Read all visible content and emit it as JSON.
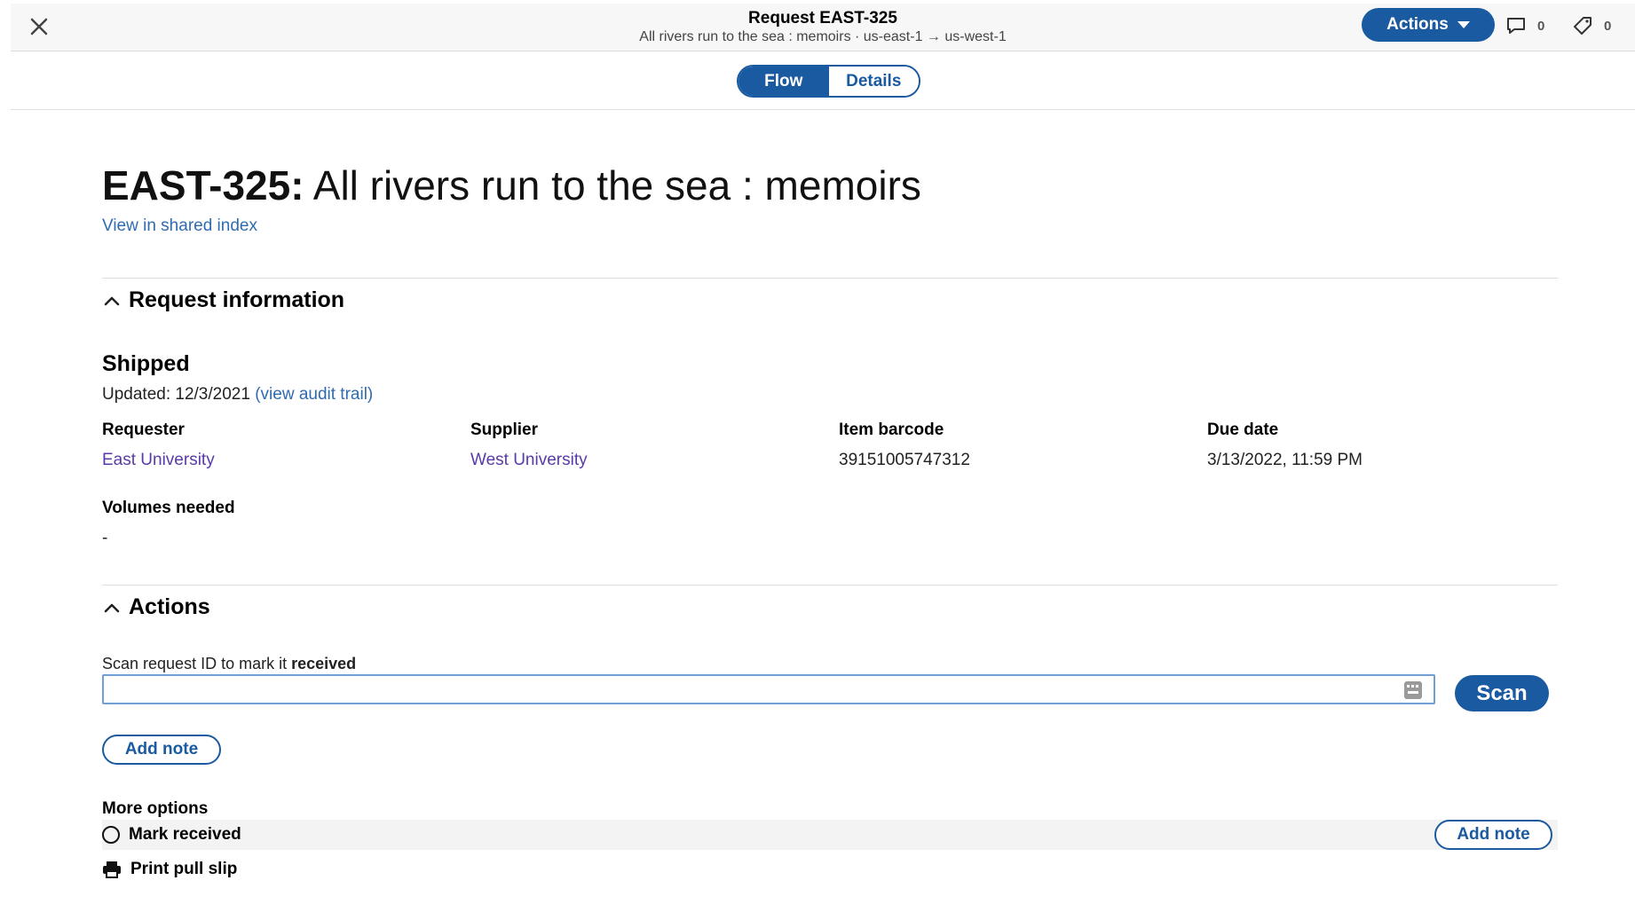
{
  "header": {
    "title": "Request EAST-325",
    "subtitle": "All rivers run to the sea : memoirs · us-east-1 → us-west-1",
    "actions_label": "Actions",
    "chat_count": "0",
    "tag_count": "0"
  },
  "tabs": [
    {
      "label": "Flow",
      "active": true
    },
    {
      "label": "Details",
      "active": false
    }
  ],
  "request": {
    "id_label": "EAST-325:",
    "title": "All rivers run to the sea : memoirs",
    "shared_index_link": "View in shared index"
  },
  "request_info": {
    "section_title": "Request information",
    "status": "Shipped",
    "updated_prefix": "Updated: 12/3/2021",
    "audit_link": "(view audit trail)",
    "fields": [
      {
        "label": "Requester",
        "value": "East University"
      },
      {
        "label": "Supplier",
        "value": "West University"
      },
      {
        "label": "Item barcode",
        "value": "39151005747312"
      },
      {
        "label": "Due date",
        "value": "3/13/2022, 11:59 PM"
      },
      {
        "label": "Volumes needed",
        "value": "-"
      }
    ]
  },
  "actions": {
    "section_title": "Actions",
    "scan_label_prefix": "Scan request ID to mark it ",
    "scan_label_emphasis": "received",
    "scan_input_value": "",
    "scan_button": "Scan",
    "add_note_button": "Add note",
    "more_options_label": "More options",
    "mark_received": "Mark received",
    "row_add_note_button": "Add note",
    "print_pull_slip": "Print pull slip"
  },
  "colors": {
    "primary": "#1a5aa0",
    "link": "#2f6bb0",
    "purple_link": "#5a3aa8"
  }
}
